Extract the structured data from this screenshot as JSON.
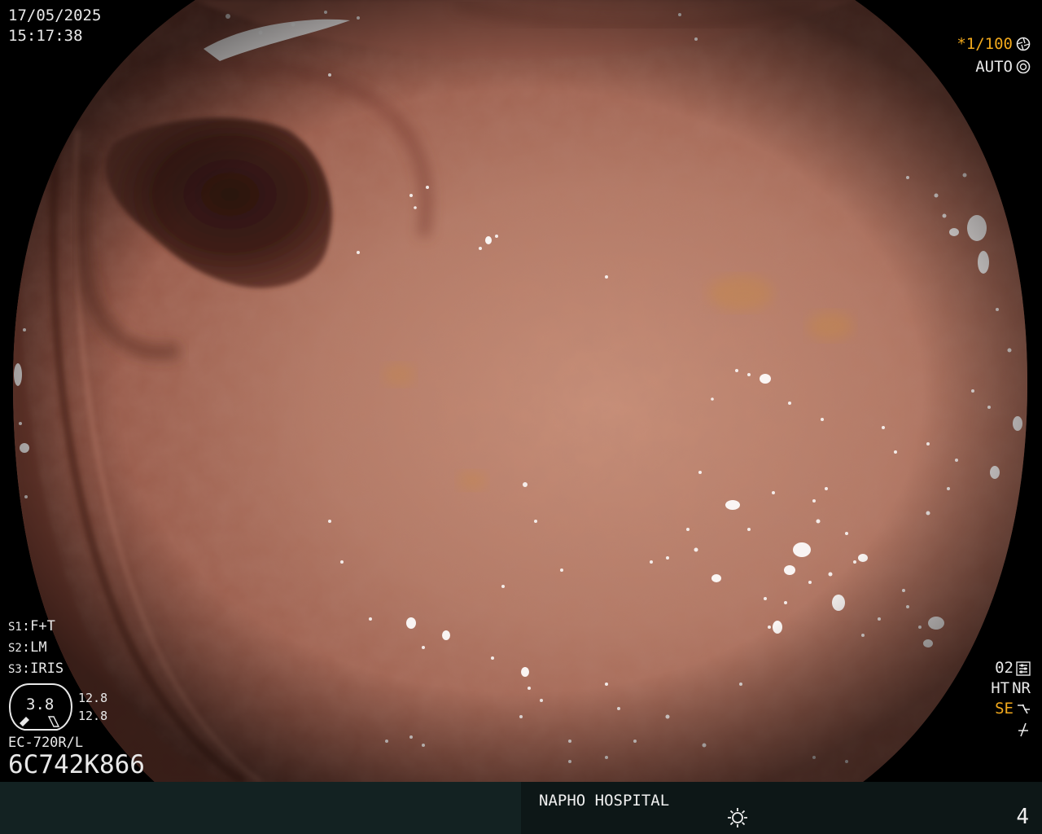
{
  "datetime": {
    "date": "17/05/2025",
    "time": "15:17:38"
  },
  "shutter": {
    "speed": "*1/100",
    "speed_icon": "shutter-icon",
    "mode": "AUTO",
    "mode_icon": "auto-iris-icon"
  },
  "settings": [
    {
      "key": "S1",
      "value": "F+T"
    },
    {
      "key": "S2",
      "value": "LM"
    },
    {
      "key": "S3",
      "value": "IRIS"
    }
  ],
  "iris_gauge": {
    "value": "3.8",
    "readout_1": "12.8",
    "readout_2": "12.8"
  },
  "scope": {
    "model": "EC-720R/L",
    "serial": "6C742K866"
  },
  "right_status": {
    "preset": "02",
    "preset_icon": "preset-settings-icon",
    "ht": "HT",
    "nr": "NR",
    "se": "SE",
    "se_icon": "structure-enhance-icon",
    "lightning_icon": "lightning-icon"
  },
  "bottom_bar": {
    "hospital": "NAPHO HOSPITAL",
    "brightness_icon": "brightness-icon",
    "image_number": "4"
  },
  "colors": {
    "osd_text": "#e8e8e8",
    "osd_amber": "#f2a91c",
    "mucosa": "#a96a58",
    "bar_left": "#132222",
    "bar_right": "#0d1717"
  }
}
